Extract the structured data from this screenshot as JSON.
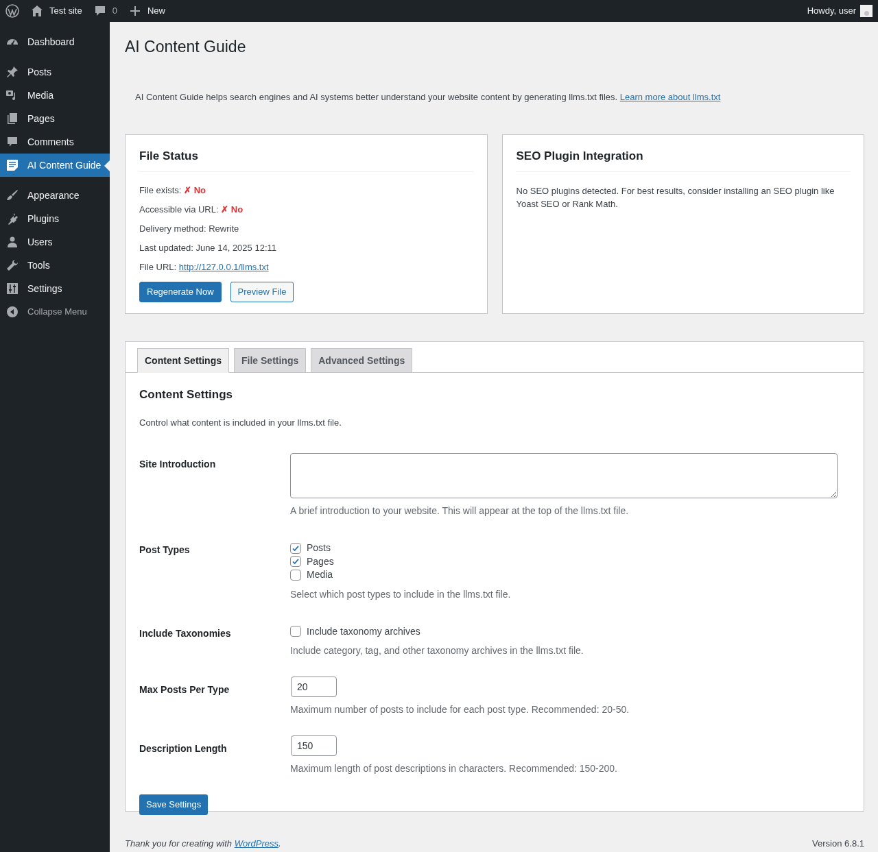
{
  "admin_bar": {
    "site": "Test site",
    "comments": "0",
    "new": "New",
    "greeting": "Howdy, user"
  },
  "sidebar": {
    "groups": [
      [
        {
          "label": "Dashboard",
          "selected": false
        }
      ],
      [
        {
          "label": "Posts",
          "selected": false
        },
        {
          "label": "Media",
          "selected": false
        },
        {
          "label": "Pages",
          "selected": false
        },
        {
          "label": "Comments",
          "selected": false
        },
        {
          "label": "AI Content Guide",
          "selected": true
        }
      ],
      [
        {
          "label": "Appearance",
          "selected": false
        },
        {
          "label": "Plugins",
          "selected": false
        },
        {
          "label": "Users",
          "selected": false
        },
        {
          "label": "Tools",
          "selected": false
        },
        {
          "label": "Settings",
          "selected": false
        }
      ]
    ],
    "collapse": "Collapse Menu"
  },
  "page_title": "AI Content Guide",
  "intro": {
    "text": "AI Content Guide helps search engines and AI systems better understand your website content by generating llms.txt files.",
    "link": "Learn more about llms.txt"
  },
  "file_status": {
    "title": "File Status",
    "rows": [
      {
        "kind": "status",
        "label": "File exists:",
        "value": "✗ No"
      },
      {
        "kind": "status",
        "label": "Accessible via URL:",
        "value": "✗ No"
      },
      {
        "kind": "plain",
        "label": "Delivery method:",
        "value": "Rewrite"
      },
      {
        "kind": "plain",
        "label": "Last updated:",
        "value": "June 14, 2025 12:11"
      },
      {
        "kind": "link",
        "label": "File URL:",
        "value": "http://127.0.0.1/llms.txt"
      }
    ],
    "buttons": [
      {
        "kind": "primary",
        "label": "Regenerate Now"
      },
      {
        "kind": "secondary",
        "label": "Preview File"
      }
    ]
  },
  "seo": {
    "title": "SEO Plugin Integration",
    "text": "No SEO plugins detected. For best results, consider installing an SEO plugin like Yoast SEO or Rank Math."
  },
  "tabs": [
    {
      "label": "Content Settings",
      "selected": true
    },
    {
      "label": "File Settings",
      "selected": false
    },
    {
      "label": "Advanced Settings",
      "selected": false
    }
  ],
  "section": {
    "title": "Content Settings",
    "description": "Control what content is included in your llms.txt file.",
    "fields": [
      {
        "kind": "textarea",
        "label": "Site Introduction",
        "help": "A brief introduction to your website. This will appear at the top of the llms.txt file."
      },
      {
        "kind": "checkboxes",
        "label": "Post Types",
        "options": [
          {
            "label": "Posts",
            "checked": true
          },
          {
            "label": "Pages",
            "checked": true
          },
          {
            "label": "Media",
            "checked": false
          }
        ],
        "help": "Select which post types to include in the llms.txt file."
      },
      {
        "kind": "checkboxes",
        "label": "Include Taxonomies",
        "options": [
          {
            "label": "Include taxonomy archives",
            "checked": false
          }
        ],
        "help": "Include category, tag, and other taxonomy archives in the llms.txt file."
      },
      {
        "kind": "number",
        "label": "Max Posts Per Type",
        "value": "20",
        "help": "Maximum number of posts to include for each post type. Recommended: 20-50."
      },
      {
        "kind": "number",
        "label": "Description Length",
        "value": "150",
        "help": "Maximum length of post descriptions in characters. Recommended: 150-200."
      }
    ],
    "save": "Save Settings"
  },
  "footer": {
    "text": "Thank you for creating with",
    "link": "WordPress",
    "end": ".",
    "version": "Version 6.8.1"
  }
}
